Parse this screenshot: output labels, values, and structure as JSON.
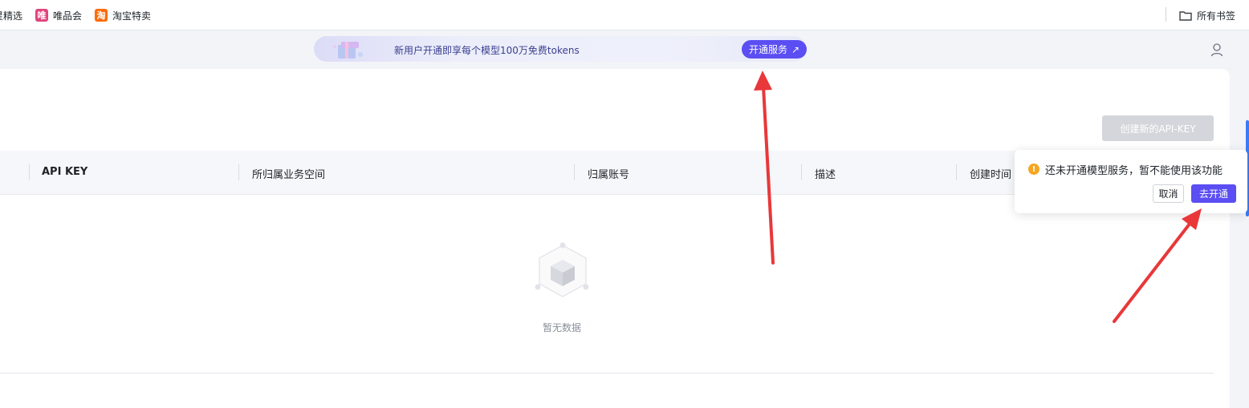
{
  "bookmarks": {
    "items": [
      {
        "label": "星精选",
        "icon": "partial-bookmark-icon",
        "color": "#ffffff"
      },
      {
        "label": "唯品会",
        "icon": "vip-icon",
        "icon_char": "唯",
        "color": "#e0457b"
      },
      {
        "label": "淘宝特卖",
        "icon": "taobao-icon",
        "icon_char": "淘",
        "color": "#ff6a00"
      }
    ],
    "all_bookmarks": "所有书签"
  },
  "banner": {
    "text": "新用户开通即享每个模型100万免费tokens",
    "button": "开通服务",
    "button_arrow": "↗",
    "accent": "#5b4ef2"
  },
  "toolbar": {
    "create_button": "创建新的API-KEY"
  },
  "table": {
    "columns": [
      "API KEY",
      "所归属业务空间",
      "归属账号",
      "描述",
      "创建时间"
    ],
    "empty_text": "暂无数据"
  },
  "popover": {
    "message": "还未开通模型服务，暂不能使用该功能",
    "cancel": "取消",
    "confirm": "去开通",
    "warn_color": "#f5a623"
  }
}
